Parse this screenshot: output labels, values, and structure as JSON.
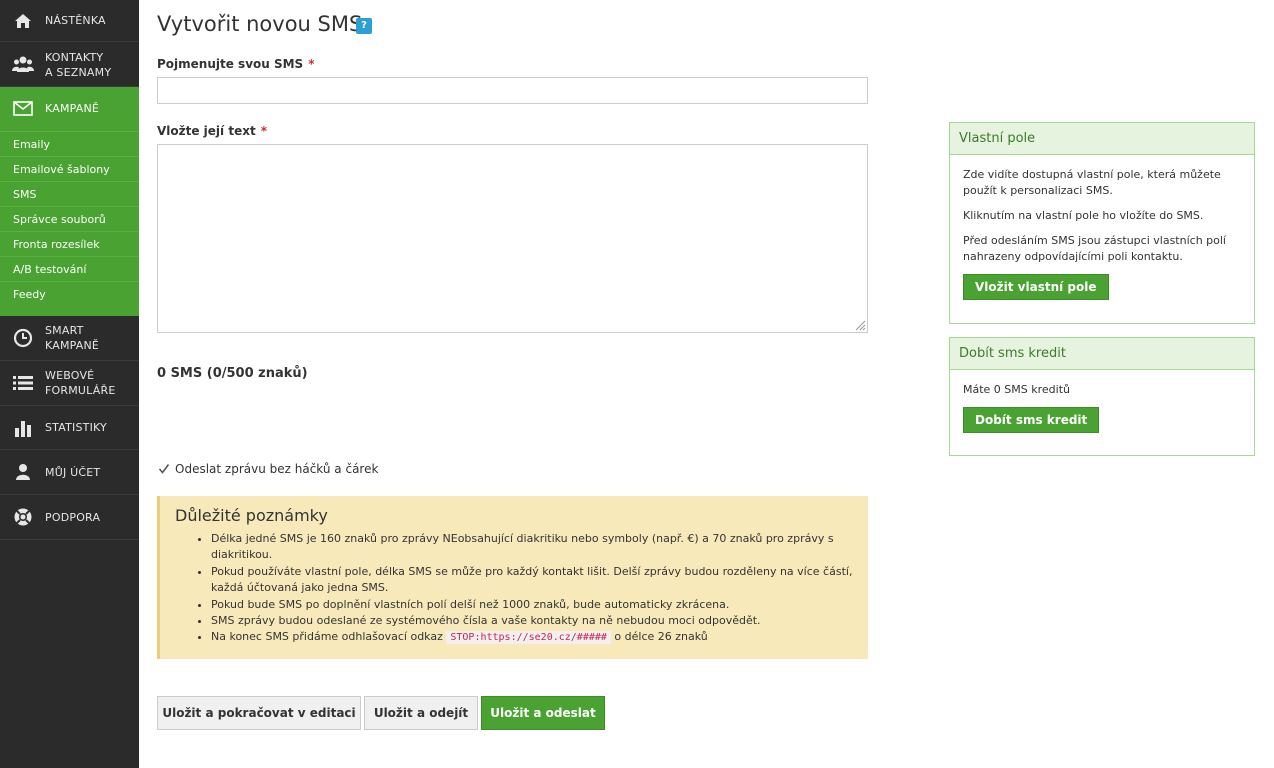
{
  "sidebar": {
    "items": [
      {
        "label": "NÁSTĚNKA",
        "icon": "home-icon"
      },
      {
        "label": "KONTAKTY",
        "label2": "A SEZNAMY",
        "icon": "users-icon"
      },
      {
        "label": "KAMPANĚ",
        "icon": "envelope-icon"
      },
      {
        "label": "SMART",
        "label2": "KAMPANĚ",
        "icon": "clock-icon"
      },
      {
        "label": "WEBOVÉ",
        "label2": "FORMULÁŘE",
        "icon": "list-icon"
      },
      {
        "label": "STATISTIKY",
        "icon": "bar-chart-icon"
      },
      {
        "label": "MŮJ ÚČET",
        "icon": "user-icon"
      },
      {
        "label": "PODPORA",
        "icon": "lifebuoy-icon"
      }
    ],
    "sub_items": [
      "Emaily",
      "Emailové šablony",
      "SMS",
      "Správce souborů",
      "Fronta rozesílek",
      "A/B testování",
      "Feedy"
    ]
  },
  "main": {
    "title": "Vytvořit novou SMS",
    "help_badge": "?",
    "name_label": "Pojmenujte svou SMS",
    "text_label": "Vložte její text",
    "required_mark": "*",
    "name_value": "",
    "text_value": "",
    "counter": "0 SMS (0/500 znaků)",
    "checkbox_label": "Odeslat zprávu bez háčků a čárek",
    "checkbox_checked": true,
    "notes": {
      "title": "Důležité poznámky",
      "items": [
        "Délka jedné SMS je 160 znaků pro zprávy NEobsahující diakritiku nebo symboly (např. €) a 70 znaků pro zprávy s diakritikou.",
        "Pokud používáte vlastní pole, délka SMS se může pro každý kontakt lišit. Delší zprávy budou rozděleny na více částí, každá účtovaná jako jedna SMS.",
        "Pokud bude SMS po doplnění vlastních polí delší než 1000 znaků, bude automaticky zkrácena.",
        "SMS zprávy budou odeslané ze systémového čísla a vaše kontakty na ně nebudou moci odpovědět."
      ],
      "last_prefix": "Na konec SMS přidáme odhlašovací odkaz",
      "last_code": "STOP:https://se20.cz/#####",
      "last_suffix": "o délce 26 znaků"
    },
    "buttons": {
      "save_continue": "Uložit a pokračovat v editaci",
      "save_leave": "Uložit a odejít",
      "save_send": "Uložit a odeslat"
    }
  },
  "panels": {
    "custom_fields": {
      "title": "Vlastní pole",
      "p1": "Zde vidíte dostupná vlastní pole, která můžete použít k personalizaci SMS.",
      "p2": "Kliknutím na vlastní pole ho vložíte do SMS.",
      "p3": "Před odesláním SMS jsou zástupci vlastních polí nahrazeny odpovídajícími poli kontaktu.",
      "button": "Vložit vlastní pole"
    },
    "credit": {
      "title": "Dobít sms kredit",
      "text": "Máte 0 SMS kreditů",
      "button": "Dobít sms kredit"
    }
  },
  "colors": {
    "accent": "#49a231",
    "sidebar_bg": "#2b2b2b",
    "notes_bg": "#f8e9bb",
    "panel_border": "#a8d79a"
  }
}
